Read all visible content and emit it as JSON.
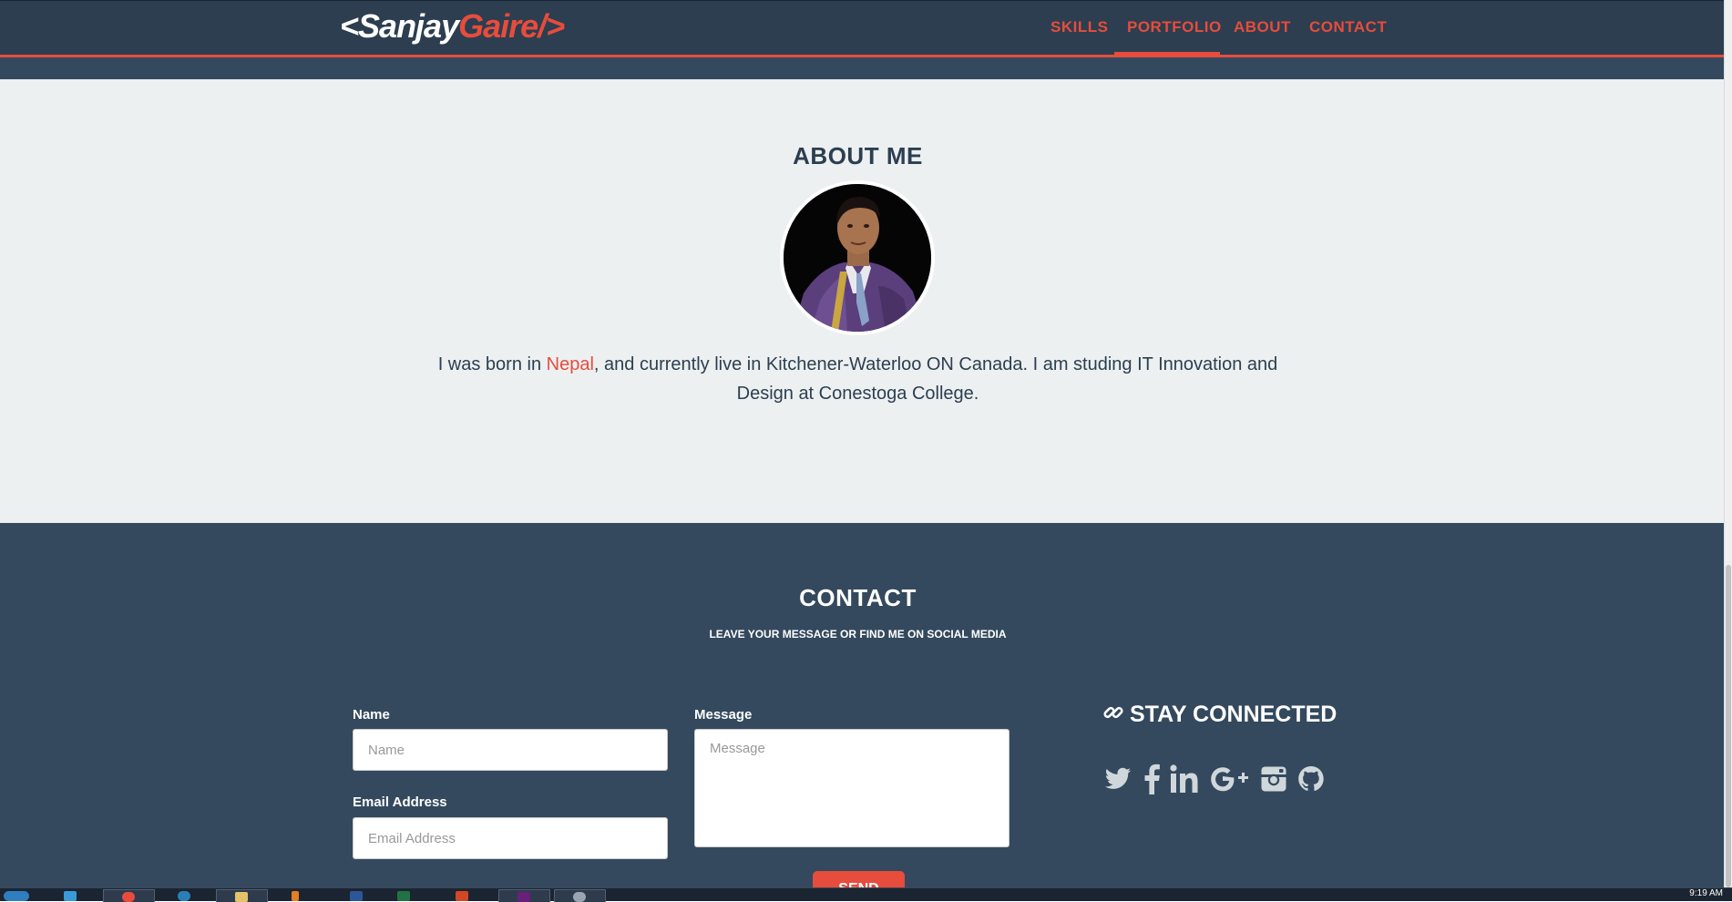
{
  "navbar": {
    "logo": {
      "open": "<",
      "first": "Sanjay",
      "last": "Gaire",
      "close": "/>"
    },
    "links": [
      {
        "label": "SKILLS"
      },
      {
        "label": "PORTFOLIO"
      },
      {
        "label": "ABOUT"
      },
      {
        "label": "CONTACT"
      }
    ],
    "active": "PORTFOLIO"
  },
  "about": {
    "title": "ABOUT ME",
    "text_before": "I was born in ",
    "highlight": "Nepal",
    "text_after": ", and currently live in Kitchener-Waterloo ON Canada. I am studing IT Innovation and Design at Conestoga College."
  },
  "contact": {
    "title": "CONTACT",
    "subtitle": "LEAVE YOUR MESSAGE OR FIND ME ON SOCIAL MEDIA",
    "name_label": "Name",
    "name_placeholder": "Name",
    "email_label": "Email Address",
    "email_placeholder": "Email Address",
    "message_label": "Message",
    "message_placeholder": "Message",
    "send_label": "SEND",
    "stay_connected": "STAY CONNECTED",
    "social_icons": [
      "twitter-icon",
      "facebook-icon",
      "linkedin-icon",
      "google-plus-icon",
      "instagram-icon",
      "github-icon"
    ]
  },
  "taskbar": {
    "clock": "9:19 AM"
  },
  "colors": {
    "accent": "#e74c3c",
    "navbar_bg": "#2c3e50",
    "contact_bg": "#34495e",
    "about_bg": "#ecf0f1"
  }
}
